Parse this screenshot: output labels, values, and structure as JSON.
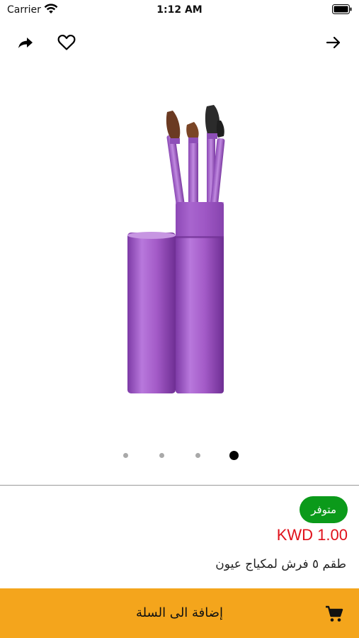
{
  "status_bar": {
    "carrier": "Carrier",
    "time": "1:12 AM"
  },
  "top_bar": {
    "icons": [
      "share-icon",
      "heart-icon",
      "arrow-right-icon"
    ]
  },
  "gallery": {
    "image": "purple-makeup-brush-set",
    "pages": 4,
    "active_page": 4
  },
  "product": {
    "availability": "متوفر",
    "price": "KWD 1.00",
    "title": "طقم ٥ فرش لمكياج عيون"
  },
  "cart": {
    "label": "إضافة الى السلة",
    "icon": "cart-icon"
  },
  "colors": {
    "badge": "#0b9a1a",
    "price": "#e0101a",
    "cart_bar": "#f4a51c",
    "product_purple": "#a45bc8"
  }
}
